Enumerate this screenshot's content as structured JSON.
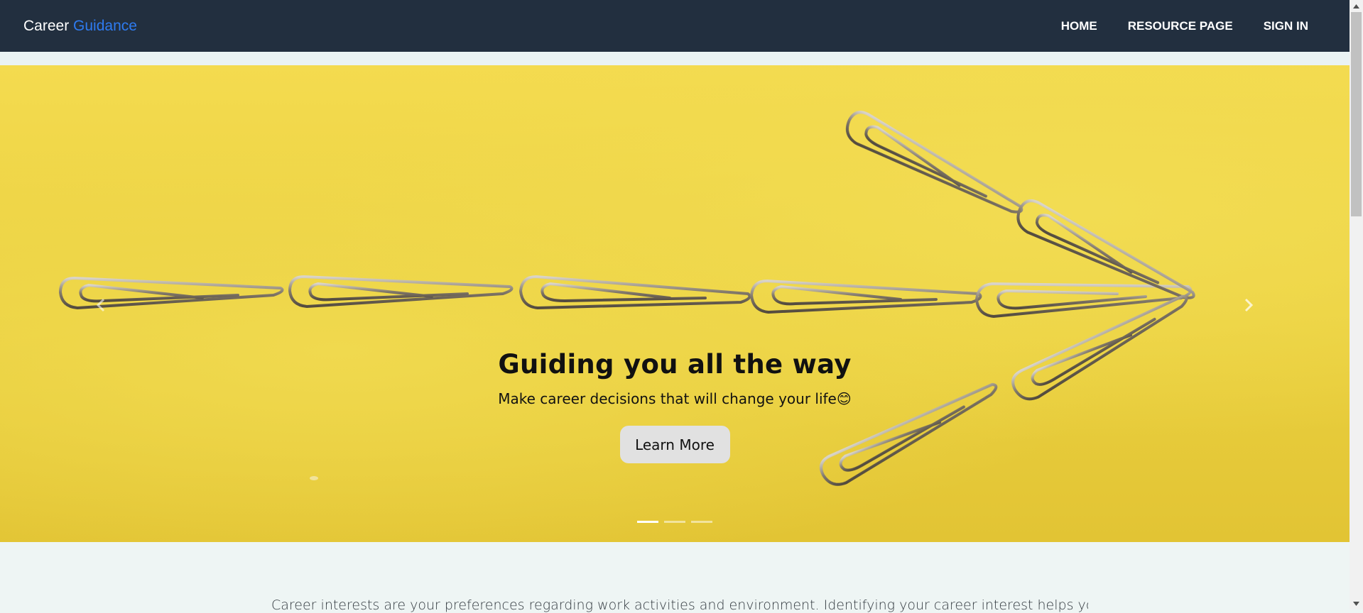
{
  "navbar": {
    "brand_primary": "Career",
    "brand_accent": "Guidance",
    "links": [
      {
        "label": "HOME"
      },
      {
        "label": "RESOURCE PAGE"
      },
      {
        "label": "SIGN IN"
      }
    ]
  },
  "hero": {
    "title": "Guiding you all the way",
    "subtitle": "Make career decisions that will change your life",
    "subtitle_emoji": "😊",
    "button_label": "Learn More",
    "slides_count": 3,
    "active_slide": 1,
    "prev_icon": "chevron-left-icon",
    "next_icon": "chevron-right-icon"
  },
  "content": {
    "intro_text": "Career interests are your preferences regarding work activities and environment. Identifying your career interest helps you make a"
  },
  "colors": {
    "navbar_bg": "#222f3f",
    "brand_accent": "#2e7bf0",
    "hero_bg": "#efd547",
    "page_bg": "#eef5f4",
    "button_bg": "#e1e1e1"
  }
}
